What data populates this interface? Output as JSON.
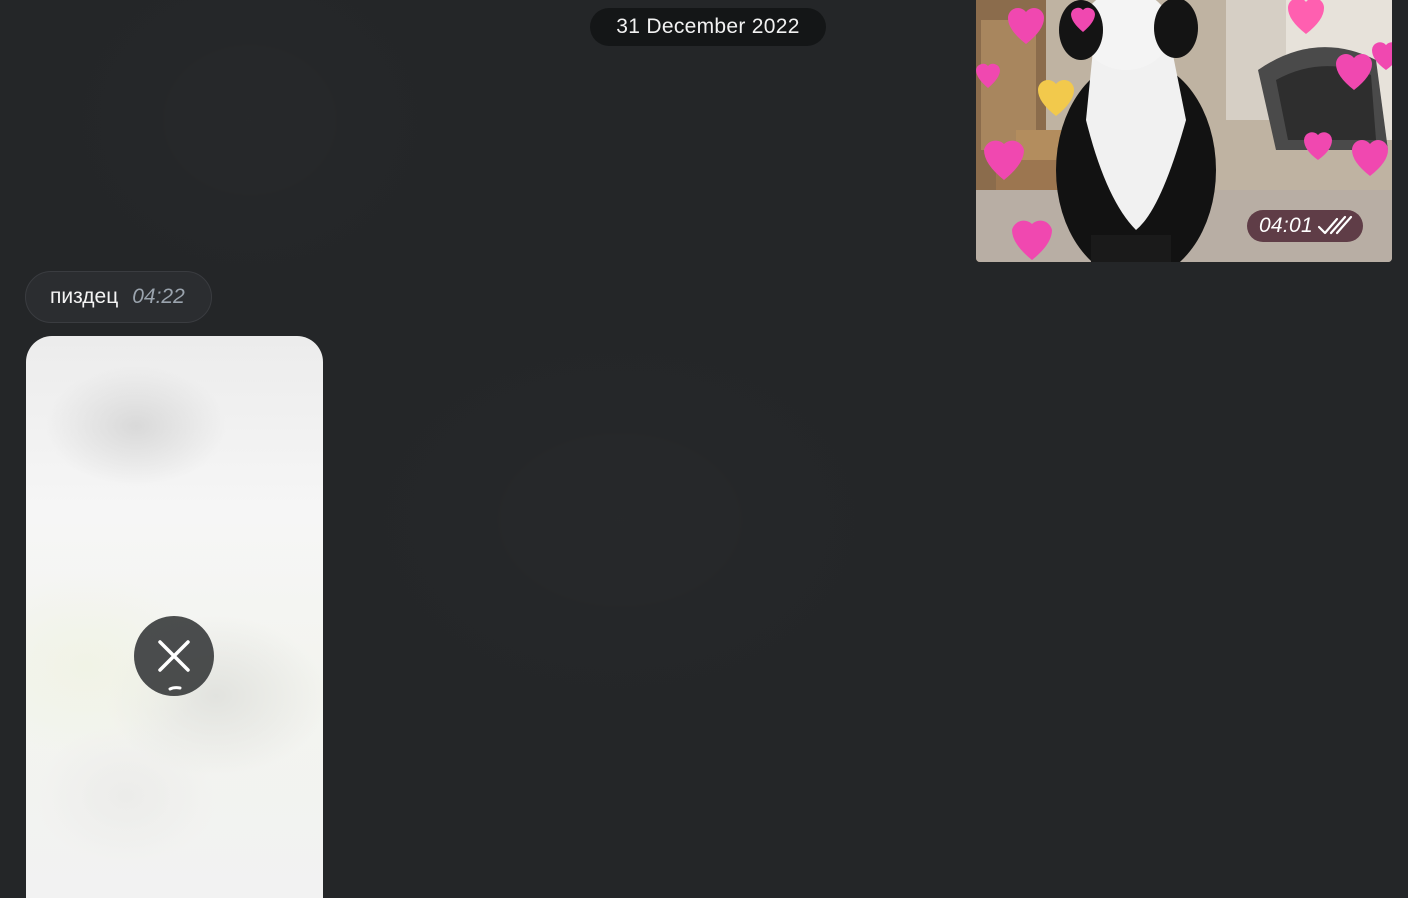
{
  "chat": {
    "date_separator": "31 December 2022",
    "messages": [
      {
        "type": "photo",
        "direction": "outgoing",
        "time": "04:01",
        "status_icon": "double-check-icon"
      },
      {
        "type": "text",
        "direction": "incoming",
        "text": "пиздец",
        "time": "04:22"
      },
      {
        "type": "media-loading",
        "direction": "incoming",
        "action_icon": "close-icon"
      }
    ]
  },
  "colors": {
    "background": "#242628",
    "bubble_incoming": "#2b2d30",
    "date_pill": "#141617",
    "time_secondary": "#9aa3ad",
    "heart_pink": "#f048b0"
  }
}
